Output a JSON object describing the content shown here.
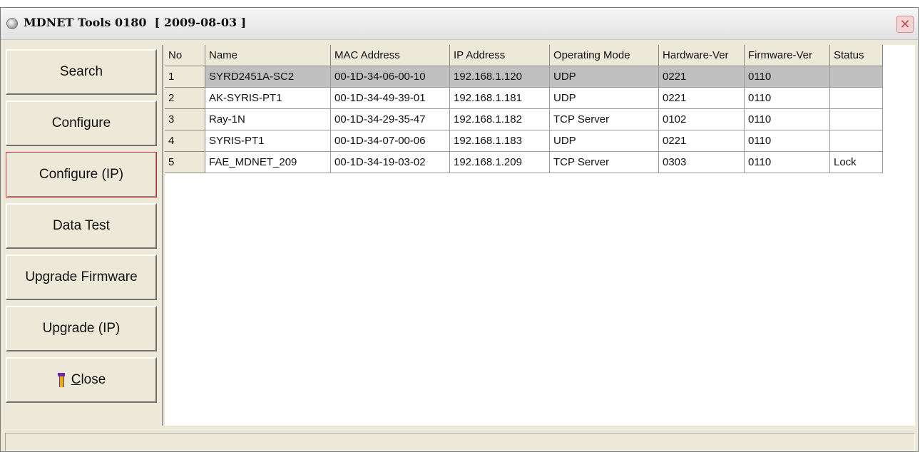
{
  "window": {
    "title": "MDNET Tools 0180  [ 2009-08-03 ]",
    "close_glyph": "✕"
  },
  "buttons": [
    {
      "label": "Search",
      "name": "search-button"
    },
    {
      "label": "Configure",
      "name": "configure-button"
    },
    {
      "label": "Configure (IP)",
      "name": "configure-ip-button",
      "focused": true
    },
    {
      "label": "Data Test",
      "name": "data-test-button"
    },
    {
      "label": "Upgrade Firmware",
      "name": "upgrade-firmware-button"
    },
    {
      "label": "Upgrade (IP)",
      "name": "upgrade-ip-button"
    },
    {
      "label": "Close",
      "name": "close-button",
      "icon": "door-exit-icon"
    }
  ],
  "table": {
    "columns": [
      "No",
      "Name",
      "MAC Address",
      "IP Address",
      "Operating Mode",
      "Hardware-Ver",
      "Firmware-Ver",
      "Status"
    ],
    "rows": [
      [
        "1",
        "SYRD2451A-SC2",
        "00-1D-34-06-00-10",
        "192.168.1.120",
        "UDP",
        "0221",
        "0110",
        ""
      ],
      [
        "2",
        "AK-SYRIS-PT1",
        "00-1D-34-49-39-01",
        "192.168.1.181",
        "UDP",
        "0221",
        "0110",
        ""
      ],
      [
        "3",
        "Ray-1N",
        "00-1D-34-29-35-47",
        "192.168.1.182",
        "TCP Server",
        "0102",
        "0110",
        ""
      ],
      [
        "4",
        "SYRIS-PT1",
        "00-1D-34-07-00-06",
        "192.168.1.183",
        "UDP",
        "0221",
        "0110",
        ""
      ],
      [
        "5",
        "FAE_MDNET_209",
        "00-1D-34-19-03-02",
        "192.168.1.209",
        "TCP Server",
        "0303",
        "0110",
        "Lock"
      ]
    ],
    "selected_row": 0
  },
  "status_bar": {
    "text": ""
  }
}
